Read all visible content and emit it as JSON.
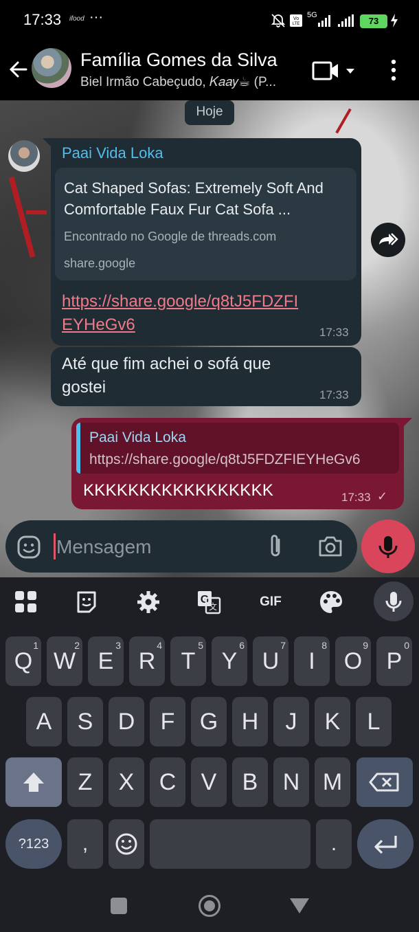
{
  "status_bar": {
    "time": "17:33",
    "carrier_icon": "ifood",
    "overflow": "···",
    "network": "5G",
    "battery": "73",
    "icons": [
      "bell-off-icon",
      "volte-icon",
      "signal-icon",
      "wifi-signal-icon",
      "battery-icon",
      "charging-icon"
    ]
  },
  "header": {
    "title": "Família Gomes da Silva",
    "subtitle": "Biel Irmão Cabeçudo, 𝐾𝑎𝑎𝑦☕ (P..."
  },
  "chat": {
    "date_chip": "Hoje",
    "messages": [
      {
        "sender": "Paai Vida Loka",
        "link_preview": {
          "title": "Cat Shaped Sofas: Extremely Soft And Comfortable Faux Fur Cat Sofa ...",
          "description": "Encontrado no Google de threads.com",
          "domain": "share.google"
        },
        "link": "https://share.google/q8tJ5FDZFIEYHeGv6",
        "time": "17:33"
      },
      {
        "text": "Até que fim achei o sofá que gostei",
        "time": "17:33"
      },
      {
        "quote_sender": "Paai Vida Loka",
        "quote_text": "https://share.google/q8tJ5FDZFIEYHeGv6",
        "text": "KKKKKKKKKKKKKKKKK",
        "time": "17:33",
        "status": "✓"
      }
    ]
  },
  "composer": {
    "placeholder": "Mensagem"
  },
  "keyboard": {
    "toolbar": [
      "apps-grid-icon",
      "sticker-icon",
      "settings-gear-icon",
      "translate-icon",
      "GIF",
      "palette-icon",
      "mic-icon"
    ],
    "gif_label": "GIF",
    "row1": [
      {
        "letter": "Q",
        "num": "1"
      },
      {
        "letter": "W",
        "num": "2"
      },
      {
        "letter": "E",
        "num": "3"
      },
      {
        "letter": "R",
        "num": "4"
      },
      {
        "letter": "T",
        "num": "5"
      },
      {
        "letter": "Y",
        "num": "6"
      },
      {
        "letter": "U",
        "num": "7"
      },
      {
        "letter": "I",
        "num": "8"
      },
      {
        "letter": "O",
        "num": "9"
      },
      {
        "letter": "P",
        "num": "0"
      }
    ],
    "row2": [
      "A",
      "S",
      "D",
      "F",
      "G",
      "H",
      "J",
      "K",
      "L"
    ],
    "row3": [
      "Z",
      "X",
      "C",
      "V",
      "B",
      "N",
      "M"
    ],
    "sym_label": "?123",
    "comma": ",",
    "period": "."
  },
  "colors": {
    "accent_out": "#7a1733",
    "bubble_in": "#1f2c34",
    "link": "#f07a8a",
    "sender_name": "#53bdeb",
    "mic_button": "#d9455a"
  }
}
